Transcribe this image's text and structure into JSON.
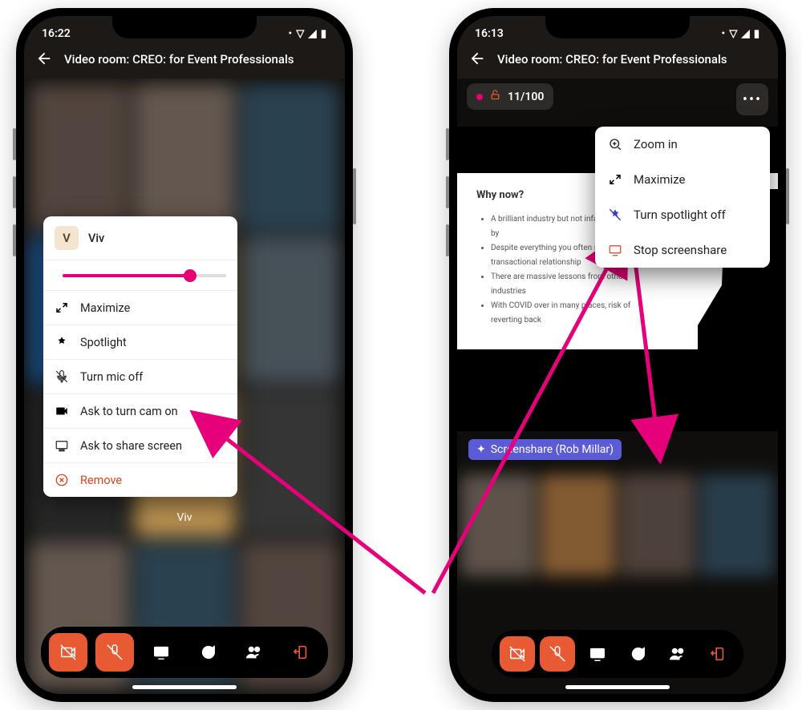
{
  "phone1": {
    "status_time": "16:22",
    "title": "Video room: CREO: for Event Professionals",
    "popup": {
      "avatar_initial": "V",
      "name": "Viv",
      "maximize": "Maximize",
      "spotlight": "Spotlight",
      "turn_mic_off": "Turn mic off",
      "ask_cam_on": "Ask to turn cam on",
      "ask_share": "Ask to share screen",
      "remove": "Remove"
    },
    "participant_caption": "Viv"
  },
  "phone2": {
    "status_time": "16:13",
    "title": "Video room: CREO: for Event Professionals",
    "info_chip": {
      "participants": "11/100"
    },
    "menu": {
      "zoom_in": "Zoom in",
      "maximize": "Maximize",
      "spotlight_off": "Turn spotlight off",
      "stop_share": "Stop screenshare"
    },
    "slide": {
      "heading": "Why now?",
      "b1": "A brilliant industry but not infallible – as shown by",
      "b2": "Despite everything you often still have a 3 day transactional relationship",
      "b3": "There are massive lessons from other industries",
      "b4": "With COVID over in many places, risk of reverting back"
    },
    "share_badge": "Screenshare (Rob Millar)"
  },
  "colors": {
    "accent": "#e85a33",
    "magenta": "#e60073",
    "badge": "#5b5bd6"
  }
}
